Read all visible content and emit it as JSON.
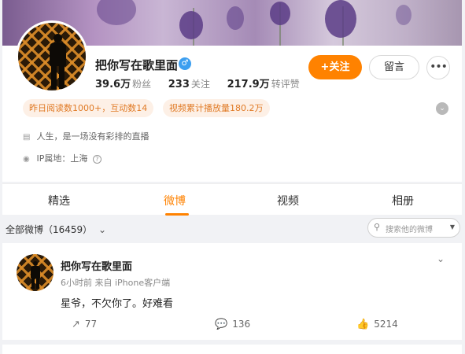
{
  "profile": {
    "name": "把你写在歌里面",
    "gender_icon": "♂",
    "stats": [
      {
        "value": "39.6万",
        "label": "粉丝"
      },
      {
        "value": "233",
        "label": "关注"
      },
      {
        "value": "217.9万",
        "label": "转评赞"
      }
    ],
    "follow_button": "+关注",
    "message_button": "留言",
    "more_button": "•••",
    "tags": [
      "昨日阅读数1000+，互动数14",
      "视频累计播放量180.2万"
    ],
    "expand_icon": "⌄",
    "bio": "人生，是一场没有彩排的直播",
    "ip": "IP属地：上海",
    "help_icon": "?"
  },
  "tabs": [
    "精选",
    "微博",
    "视频",
    "相册"
  ],
  "active_tab_index": 1,
  "feed_filter": {
    "label": "全部微博（16459）",
    "chevron": "⌄",
    "search_placeholder": "搜索他的微博",
    "search_icon": "⚲",
    "caret": "▼"
  },
  "post": {
    "author": "把你写在歌里面",
    "meta": "6小时前  来自 iPhone客户端",
    "menu_chevron": "⌄",
    "text": "星爷，不欠你了。好难看",
    "reposts": "77",
    "comments": "136",
    "likes": "5214",
    "icons": {
      "repost": "↗",
      "comment": "💬",
      "like": "👍"
    }
  },
  "colors": {
    "accent": "#ff8200",
    "tag_bg": "#fdf0e6",
    "tag_text": "#e07a25",
    "page_bg": "#f1f2f5"
  }
}
